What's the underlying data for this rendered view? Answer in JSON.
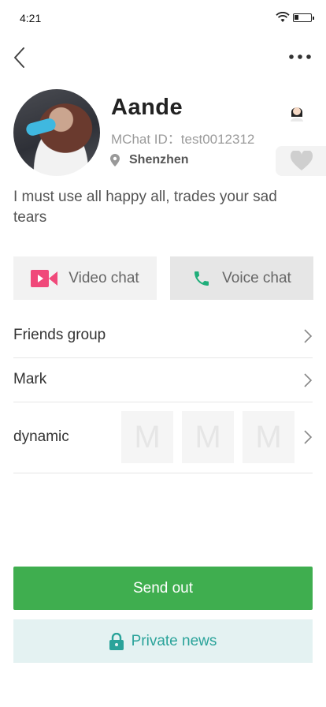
{
  "status_bar": {
    "time": "4:21"
  },
  "profile": {
    "name": "Aande",
    "mchat_id": "MChat ID：test0012312",
    "location": "Shenzhen",
    "signature": "I must use all happy all, trades your sad tears"
  },
  "actions": {
    "video_chat": "Video chat",
    "voice_chat": "Voice chat"
  },
  "menu": {
    "friends_group": "Friends group",
    "mark": "Mark",
    "dynamic": "dynamic",
    "thumb_placeholder": [
      "M",
      "M",
      "M"
    ]
  },
  "footer": {
    "send_out": "Send out",
    "private_news": "Private news"
  },
  "colors": {
    "green": "#3fae4f",
    "teal": "#2aa39a",
    "pink": "#f0497a",
    "voice_green": "#1fae7a"
  }
}
